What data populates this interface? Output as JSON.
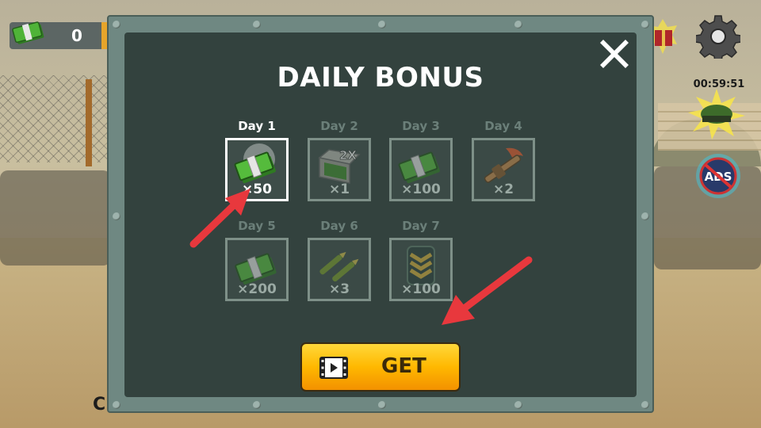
{
  "hud": {
    "money_value": "0",
    "money_icon": "cash-icon",
    "timer": "00:59:51",
    "partial_text": "C"
  },
  "dialog": {
    "title": "DAILY BONUS",
    "close_icon": "close-icon",
    "days": [
      {
        "label": "Day 1",
        "qty": "×50",
        "icon": "cash-stack-icon",
        "state": "available"
      },
      {
        "label": "Day 2",
        "qty": "×1",
        "badge": "2X",
        "icon": "double-money-case-icon",
        "state": "locked"
      },
      {
        "label": "Day 3",
        "qty": "×100",
        "icon": "cash-stack-icon",
        "state": "locked"
      },
      {
        "label": "Day 4",
        "qty": "×2",
        "icon": "flamethrower-icon",
        "state": "locked"
      },
      {
        "label": "Day 5",
        "qty": "×200",
        "icon": "cash-stack-icon",
        "state": "locked"
      },
      {
        "label": "Day 6",
        "qty": "×3",
        "icon": "missiles-icon",
        "state": "locked"
      },
      {
        "label": "Day 7",
        "qty": "×100",
        "icon": "rank-chevron-icon",
        "state": "locked"
      }
    ],
    "get_button": {
      "label": "GET",
      "icon": "video-film-icon"
    }
  },
  "colors": {
    "panel_frame": "#6f8882",
    "panel_inner": "#33423e",
    "button_yellow": "#ffb800",
    "arrow_red": "#e8383d",
    "cash_green": "#3f9a2c"
  }
}
